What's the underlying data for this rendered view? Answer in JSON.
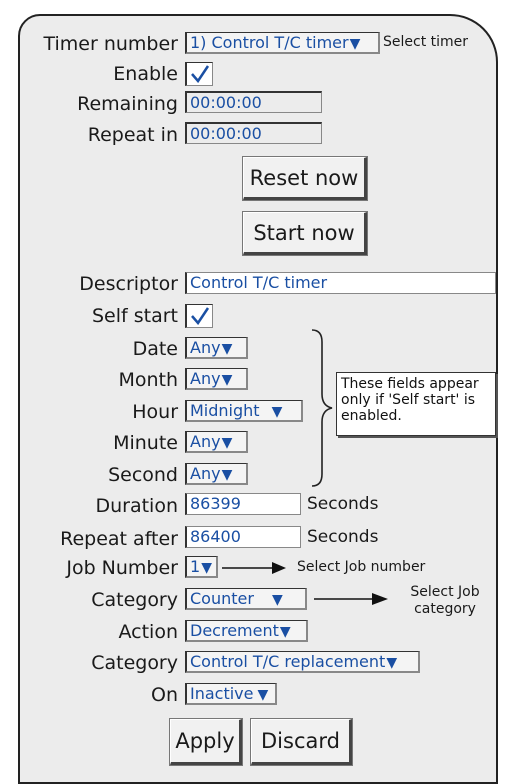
{
  "timer_number": {
    "label": "Timer number",
    "value": "1) Control T/C timer",
    "hint": "Select timer"
  },
  "enable": {
    "label": "Enable",
    "checked": true
  },
  "remaining": {
    "label": "Remaining",
    "value": "00:00:00"
  },
  "repeat_in": {
    "label": "Repeat in",
    "value": "00:00:00"
  },
  "reset_button": "Reset now",
  "start_button": "Start now",
  "descriptor": {
    "label": "Descriptor",
    "value": "Control T/C timer"
  },
  "self_start": {
    "label": "Self start",
    "checked": true
  },
  "date": {
    "label": "Date",
    "value": "Any"
  },
  "month": {
    "label": "Month",
    "value": "Any"
  },
  "hour": {
    "label": "Hour",
    "value": "Midnight"
  },
  "minute": {
    "label": "Minute",
    "value": "Any"
  },
  "second": {
    "label": "Second",
    "value": "Any"
  },
  "note": "These fields appear only if 'Self start' is enabled.",
  "duration": {
    "label": "Duration",
    "value": "86399",
    "unit": "Seconds"
  },
  "repeat_after": {
    "label": "Repeat after",
    "value": "86400",
    "unit": "Seconds"
  },
  "job_number": {
    "label": "Job Number",
    "value": "1",
    "hint": "Select Job number"
  },
  "category1": {
    "label": "Category",
    "value": "Counter",
    "hint": "Select Job category"
  },
  "action": {
    "label": "Action",
    "value": "Decrement"
  },
  "category2": {
    "label": "Category",
    "value": "Control T/C replacement"
  },
  "on": {
    "label": "On",
    "value": "Inactive"
  },
  "apply_button": "Apply",
  "discard_button": "Discard",
  "colors": {
    "field_text": "#1a4fa3",
    "panel": "#ececec"
  },
  "icons": {
    "dropdown": "triangle-down-icon",
    "checkbox": "checkmark-icon",
    "arrow": "arrow-right-icon"
  }
}
